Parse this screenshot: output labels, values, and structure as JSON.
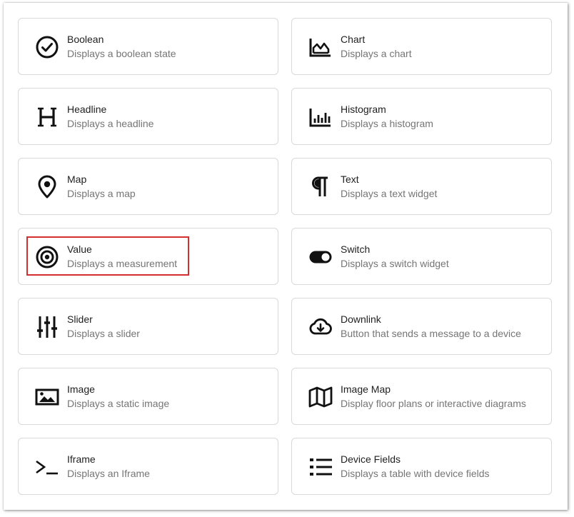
{
  "widgets": [
    {
      "title": "Boolean",
      "desc": "Displays a boolean state",
      "icon": "check-circle-icon"
    },
    {
      "title": "Chart",
      "desc": "Displays a chart",
      "icon": "area-chart-icon"
    },
    {
      "title": "Headline",
      "desc": "Displays a headline",
      "icon": "headline-h-icon"
    },
    {
      "title": "Histogram",
      "desc": "Displays a histogram",
      "icon": "histogram-icon"
    },
    {
      "title": "Map",
      "desc": "Displays a map",
      "icon": "map-pin-icon"
    },
    {
      "title": "Text",
      "desc": "Displays a text widget",
      "icon": "pilcrow-icon"
    },
    {
      "title": "Value",
      "desc": "Displays a measurement",
      "icon": "target-icon"
    },
    {
      "title": "Switch",
      "desc": "Displays a switch widget",
      "icon": "toggle-icon"
    },
    {
      "title": "Slider",
      "desc": "Displays a slider",
      "icon": "sliders-icon"
    },
    {
      "title": "Downlink",
      "desc": "Button that sends a message to a device",
      "icon": "cloud-download-icon"
    },
    {
      "title": "Image",
      "desc": "Displays a static image",
      "icon": "image-icon"
    },
    {
      "title": "Image Map",
      "desc": "Display floor plans or interactive diagrams",
      "icon": "folded-map-icon"
    },
    {
      "title": "Iframe",
      "desc": "Displays an Iframe",
      "icon": "terminal-icon"
    },
    {
      "title": "Device Fields",
      "desc": "Displays a table with device fields",
      "icon": "list-icon"
    }
  ],
  "highlight_color": "#d32f2f"
}
